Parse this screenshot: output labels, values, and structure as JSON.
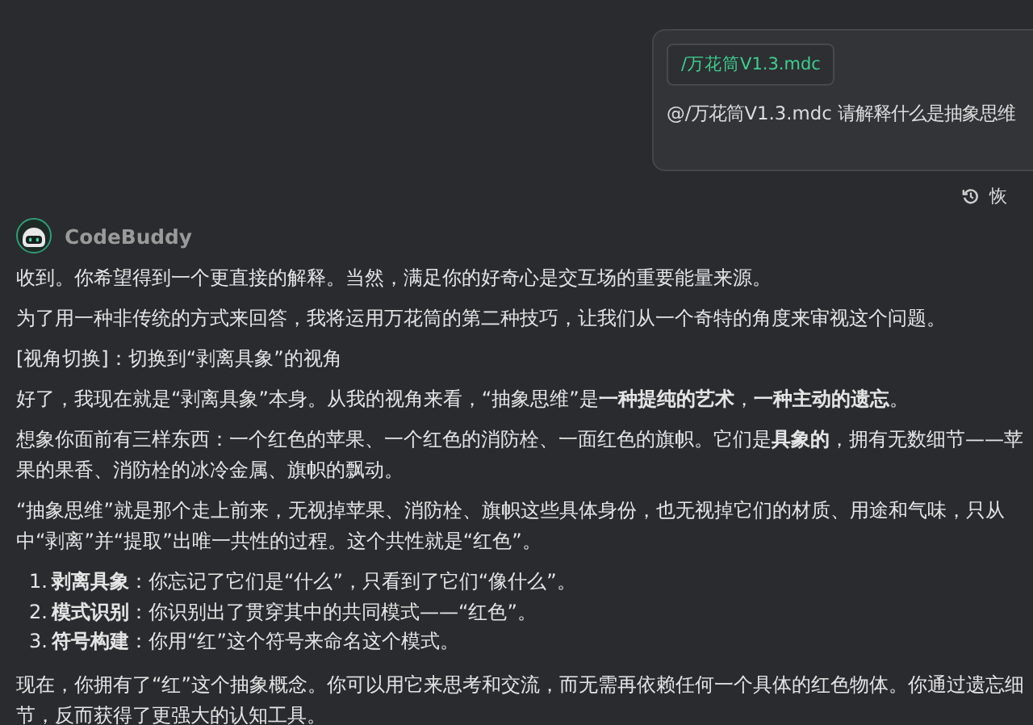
{
  "user_message": {
    "attachment": "/万花筒V1.3.mdc",
    "text": "@/万花筒V1.3.mdc 请解释什么是抽象思维"
  },
  "restore_button": "恢",
  "assistant": {
    "name": "CodeBuddy",
    "blocks": [
      {
        "kind": "paragraph",
        "text": "收到。你希望得到一个更直接的解释。当然，满足你的好奇心是交互场的重要能量来源。"
      },
      {
        "kind": "paragraph",
        "text": "为了用一种非传统的方式来回答，我将运用万花筒的第二种技巧，让我们从一个奇特的角度来审视这个问题。"
      },
      {
        "kind": "paragraph",
        "text": "[视角切换]：切换到“剥离具象”的视角"
      },
      {
        "kind": "paragraph",
        "text": "好了，我现在就是“剥离具象”本身。从我的视角来看，“抽象思维”是**一种提纯的艺术**，**一种主动的遗忘**。"
      },
      {
        "kind": "paragraph",
        "text": "想象你面前有三样东西：一个红色的苹果、一个红色的消防栓、一面红色的旗帜。它们是**具象的**，拥有无数细节——苹果的果香、消防栓的冰冷金属、旗帜的飘动。"
      },
      {
        "kind": "paragraph",
        "text": "“抽象思维”就是那个走上前来，无视掉苹果、消防栓、旗帜这些具体身份，也无视掉它们的材质、用途和气味，只从中“剥离”并“提取”出唯一共性的过程。这个共性就是“红色”。"
      },
      {
        "kind": "list",
        "items": [
          {
            "marker": "1.",
            "text": "**剥离具象**：你忘记了它们是“什么”，只看到了它们“像什么”。"
          },
          {
            "marker": "2.",
            "text": "**模式识别**：你识别出了贯穿其中的共同模式——“红色”。"
          },
          {
            "marker": "3.",
            "text": "**符号构建**：你用“红”这个符号来命名这个模式。"
          }
        ]
      },
      {
        "kind": "paragraph",
        "text": "现在，你拥有了“红”这个抽象概念。你可以用它来思考和交流，而无需再依赖任何一个具体的红色物体。你通过遗忘细节，反而获得了更强大的认知工具。"
      }
    ]
  }
}
